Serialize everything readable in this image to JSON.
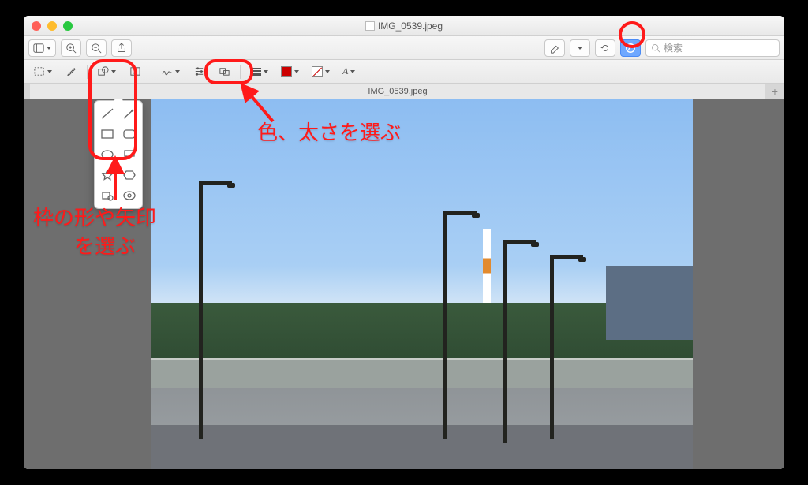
{
  "window": {
    "title": "IMG_0539.jpeg",
    "tab_label": "IMG_0539.jpeg"
  },
  "search": {
    "placeholder": "検索"
  },
  "annotations": {
    "shapes_label": "枠の形や矢印\n　　を選ぶ",
    "color_label": "色、太さを選ぶ"
  },
  "colors": {
    "annotation": "#ff1a1a",
    "border_swatch": "#cc0000"
  },
  "shape_popover": {
    "items": [
      "line",
      "arrow",
      "rect",
      "rounded-rect",
      "ellipse",
      "speech-bubble",
      "star",
      "hexagon",
      "loupe",
      "mask"
    ]
  }
}
